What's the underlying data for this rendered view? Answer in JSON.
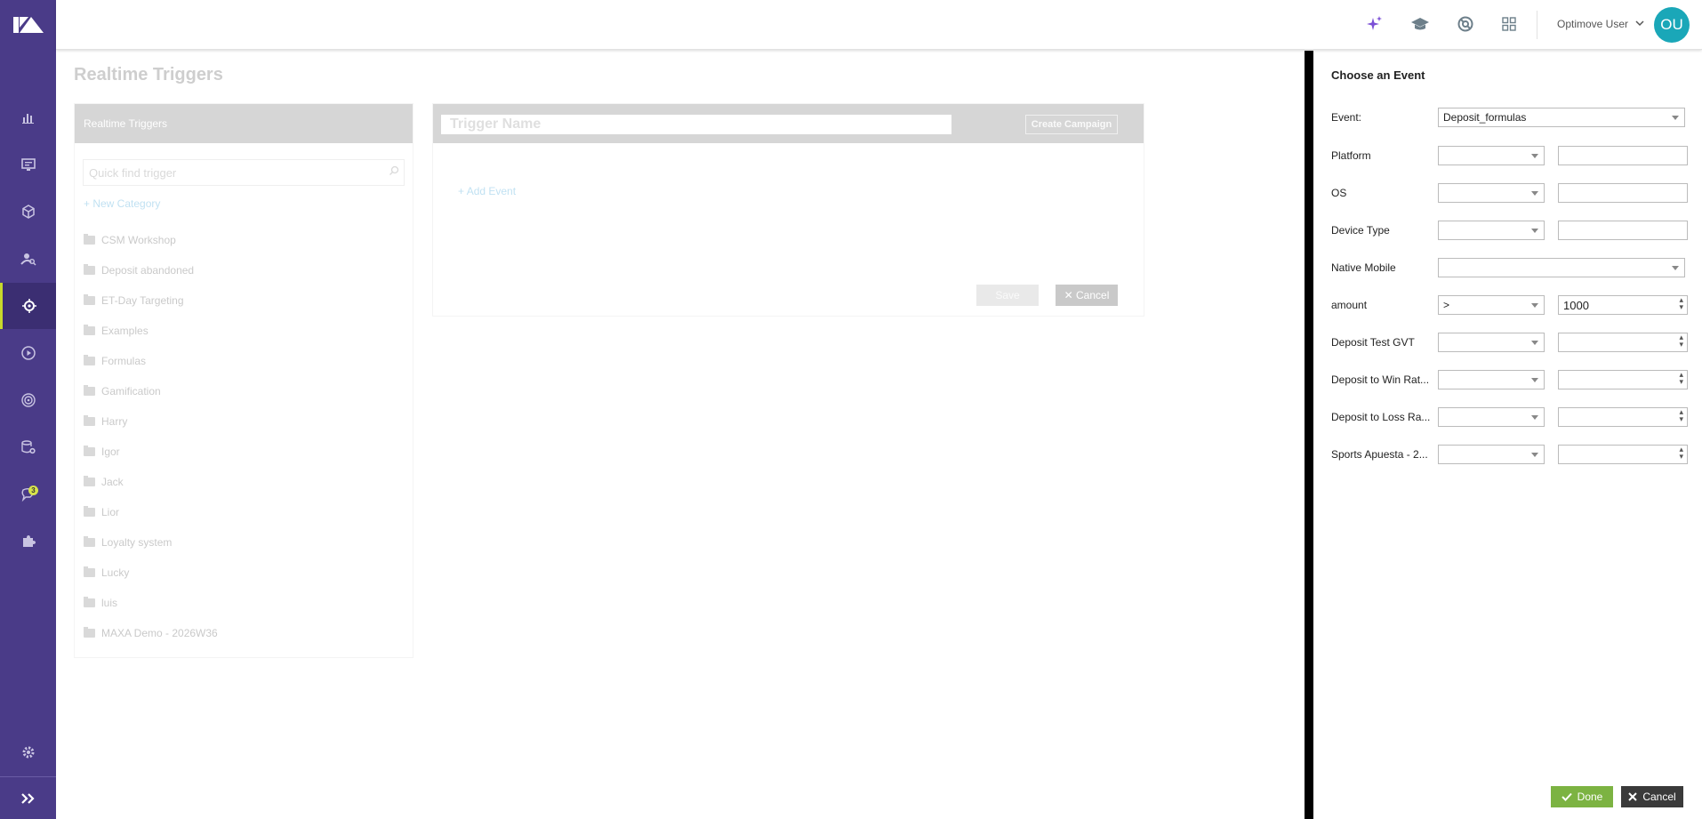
{
  "topbar": {
    "user_name": "Optimove User",
    "avatar_initials": "OU",
    "avatar_color": "#1aa7b8",
    "icons": [
      "sparkle-icon",
      "graduation-cap-icon",
      "support-icon",
      "apps-grid-icon"
    ]
  },
  "nav": {
    "bg_color": "#4a3b88",
    "active_accent": "#c7d92c",
    "items": [
      "analytics-icon",
      "monitor-icon",
      "cube-icon",
      "customer-search-icon",
      "target-icon",
      "play-icon",
      "realtime-icon",
      "data-settings-icon",
      "notifications-icon",
      "puzzle-icon"
    ],
    "notification_count": "3",
    "bottom": [
      "settings-icon",
      "expand-icon"
    ]
  },
  "main": {
    "page_title": "Realtime Triggers",
    "panel_title": "Realtime Triggers",
    "quick_find_placeholder": "Quick find trigger",
    "new_category": "New Category",
    "folders": [
      "CSM Workshop",
      "Deposit abandoned",
      "ET-Day Targeting",
      "Examples",
      "Formulas",
      "Gamification",
      "Harry",
      "Igor",
      "Jack",
      "Lior",
      "Loyalty system",
      "Lucky",
      "luis",
      "MAXA Demo - 2026W36"
    ],
    "trigger_name_placeholder": "Trigger Name",
    "create_campaign": "Create Campaign",
    "add_event": "Add Event",
    "save": "Save",
    "cancel": "Cancel"
  },
  "drawer": {
    "title": "Choose an Event",
    "event_label": "Event:",
    "event_value": "Deposit_formulas",
    "fields": [
      {
        "label": "Platform",
        "op": "",
        "value": "",
        "type": "text"
      },
      {
        "label": "OS",
        "op": "",
        "value": "",
        "type": "text"
      },
      {
        "label": "Device Type",
        "op": "",
        "value": "",
        "type": "text"
      },
      {
        "label": "Native Mobile",
        "op": "",
        "value": "",
        "type": "full-select"
      },
      {
        "label": "amount",
        "op": ">",
        "value": "1000",
        "type": "number"
      },
      {
        "label": "Deposit Test GVT",
        "op": "",
        "value": "",
        "type": "number"
      },
      {
        "label": "Deposit to Win Rat...",
        "op": "",
        "value": "",
        "type": "number"
      },
      {
        "label": "Deposit to Loss Ra...",
        "op": "",
        "value": "",
        "type": "number"
      },
      {
        "label": "Sports Apuesta - 2...",
        "op": "",
        "value": "",
        "type": "number"
      }
    ],
    "done": "Done",
    "cancel": "Cancel",
    "done_color": "#7cb342"
  }
}
